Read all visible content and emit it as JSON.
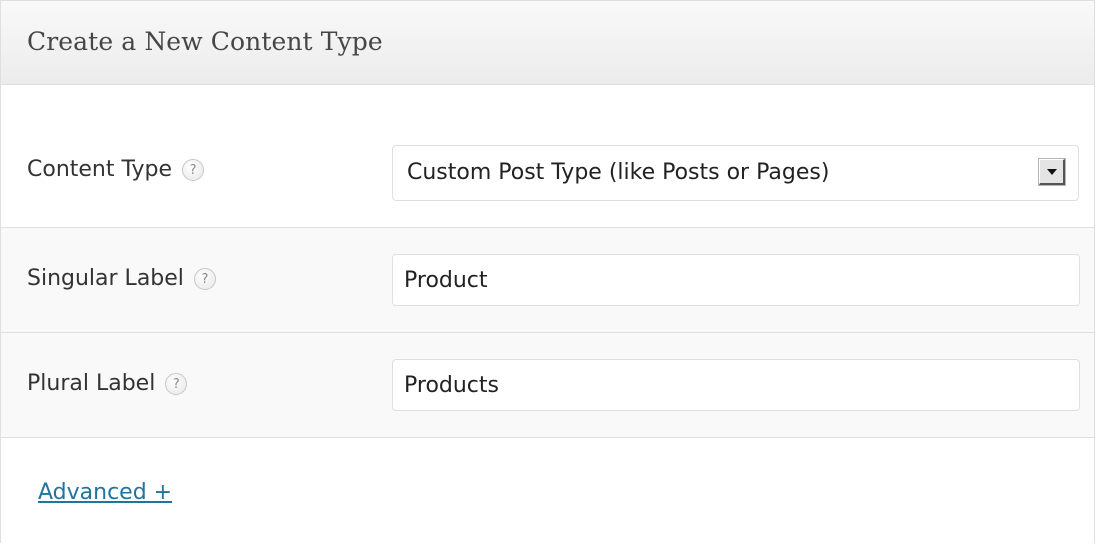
{
  "panel": {
    "title": "Create a New Content Type"
  },
  "fields": {
    "content_type": {
      "label": "Content Type",
      "help_icon": "question-mark-icon",
      "help_glyph": "?",
      "selected": "Custom Post Type (like Posts or Pages)"
    },
    "singular_label": {
      "label": "Singular Label",
      "help_icon": "question-mark-icon",
      "help_glyph": "?",
      "value": "Product"
    },
    "plural_label": {
      "label": "Plural Label",
      "help_icon": "question-mark-icon",
      "help_glyph": "?",
      "value": "Products"
    }
  },
  "advanced": {
    "link_text": "Advanced +"
  },
  "colors": {
    "link": "#21759b",
    "border": "#dfdfdf",
    "alt_row_bg": "#f9f9f9"
  }
}
